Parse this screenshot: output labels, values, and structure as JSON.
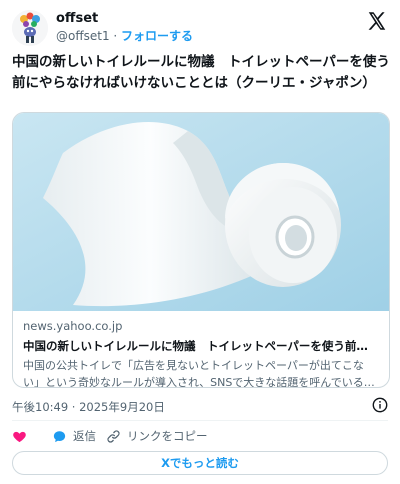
{
  "author": {
    "display_name": "offset",
    "handle": "@offset1",
    "separator": " · ",
    "follow_label": "フォローする"
  },
  "tweet": {
    "text": "中国の新しいトイレルールに物議　トイレットペーパーを使う前にやらなければいけないこととは（クーリエ・ジャポン）"
  },
  "card": {
    "domain": "news.yahoo.co.jp",
    "title": "中国の新しいトイレルールに物議　トイレットペーパーを使う前にやらなければいけないこととは",
    "description": "中国の公共トイレで「広告を見ないとトイレットペーパーが出てこない」という奇妙なルールが導入され、SNSで大きな話題を呼んでいる。動画が拡散され"
  },
  "meta": {
    "timestamp": "午後10:49 · 2025年9月20日"
  },
  "actions": {
    "reply_label": "返信",
    "copy_link_label": "リンクをコピー",
    "read_more_label": "Xでもっと読む"
  },
  "icons": {
    "x_logo": "x-logo-icon",
    "info": "info-icon",
    "like": "heart-icon",
    "reply": "speech-bubble-icon",
    "copy_link": "link-icon"
  },
  "colors": {
    "accent": "#1d9bf0",
    "like": "#f91880",
    "secondary_text": "#536471",
    "border": "#cfd9de",
    "card_image_bg": "#bfe0ee"
  }
}
